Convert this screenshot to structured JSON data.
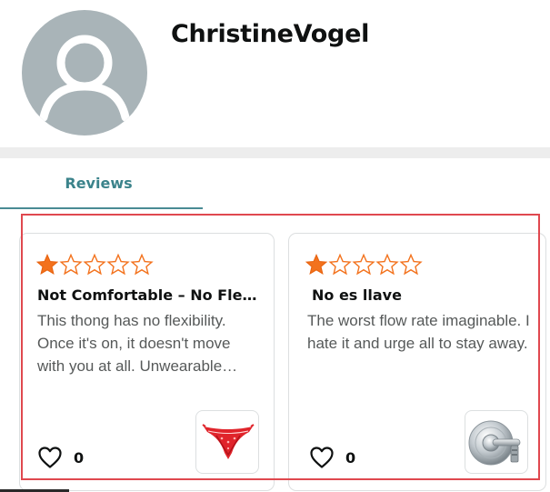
{
  "profile": {
    "name": "ChristineVogel",
    "avatar_icon": "default-user-avatar-icon"
  },
  "tabs": [
    {
      "label": "Reviews",
      "active": true
    }
  ],
  "reviews": [
    {
      "rating": 1,
      "max_rating": 5,
      "title": "Not Comfortable – No Flexibility",
      "body": "This thong has no flexibility. Once it's on, it doesn't move with you at all. Unwearable…",
      "helpful_count": "0",
      "product_image": "red-lace-thong-thumbnail"
    },
    {
      "rating": 1,
      "max_rating": 5,
      "title": "No es llave",
      "body": "The worst flow rate imaginable. I hate it and urge all to stay away.",
      "helpful_count": "0",
      "product_image": "shower-valve-faucet-thumbnail"
    }
  ],
  "colors": {
    "star_fill": "#f3721d",
    "tab_accent": "#3b838b",
    "highlight_border": "#e0484f",
    "avatar_bg": "#a9b4b8"
  }
}
